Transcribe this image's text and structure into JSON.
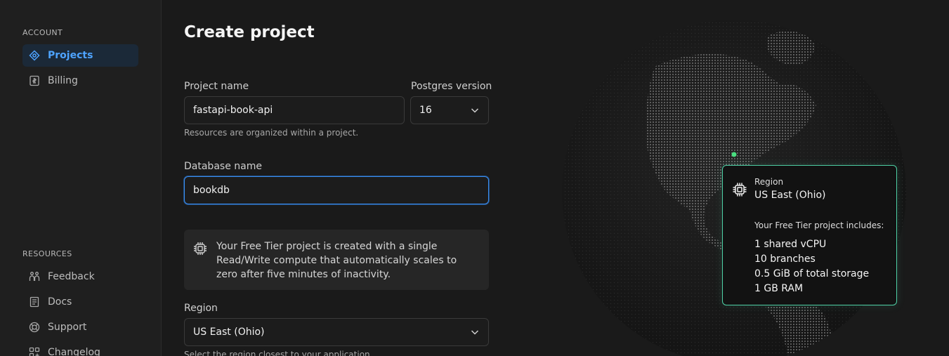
{
  "sidebar": {
    "account_label": "ACCOUNT",
    "account_items": [
      {
        "label": "Projects",
        "icon": "projects-icon",
        "active": true
      },
      {
        "label": "Billing",
        "icon": "billing-icon",
        "active": false
      }
    ],
    "resources_label": "RESOURCES",
    "resource_items": [
      {
        "label": "Feedback",
        "icon": "feedback-icon"
      },
      {
        "label": "Docs",
        "icon": "docs-icon"
      },
      {
        "label": "Support",
        "icon": "support-icon"
      },
      {
        "label": "Changelog",
        "icon": "changelog-icon"
      }
    ]
  },
  "form": {
    "title": "Create project",
    "project_name_label": "Project name",
    "project_name_value": "fastapi-book-api",
    "project_helper": "Resources are organized within a project.",
    "postgres_label": "Postgres version",
    "postgres_value": "16",
    "database_label": "Database name",
    "database_value": "bookdb",
    "info_text": "Your Free Tier project is created with a single Read/Write compute that automatically scales to zero after five minutes of inactivity.",
    "region_label": "Region",
    "region_value": "US East (Ohio)",
    "region_helper": "Select the region closest to your application."
  },
  "tooltip": {
    "region_label": "Region",
    "region_value": "US East (Ohio)",
    "includes_label": "Your Free Tier project includes:",
    "features": [
      "1 shared vCPU",
      "10 branches",
      "0.5 GiB of total storage",
      "1 GB RAM"
    ]
  },
  "colors": {
    "accent": "#4ea3ff",
    "tooltip_border": "#4fd1a6",
    "region_dot": "#4ade80"
  }
}
